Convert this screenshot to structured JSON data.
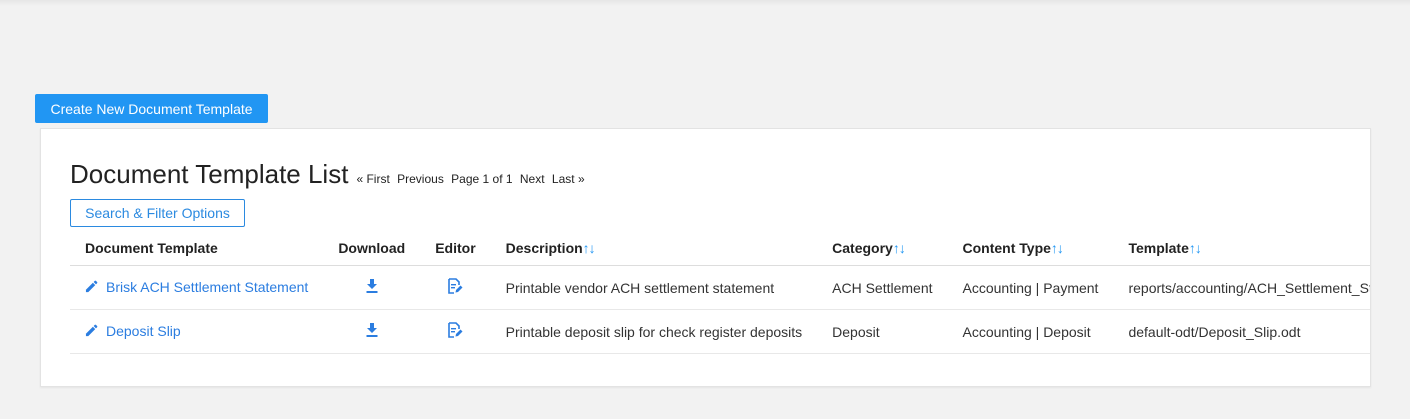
{
  "toolbar": {
    "create_label": "Create New Document Template"
  },
  "list": {
    "title": "Document Template List",
    "pager": {
      "first": "« First",
      "previous": "Previous",
      "page_info": "Page 1 of 1",
      "next": "Next",
      "last": "Last »"
    },
    "filter_label": "Search & Filter Options",
    "sort_glyph": "↑↓",
    "columns": {
      "document_template": "Document Template",
      "download": "Download",
      "editor": "Editor",
      "description": "Description",
      "category": "Category",
      "content_type": "Content Type",
      "template": "Template"
    },
    "rows": [
      {
        "name": "Brisk ACH Settlement Statement",
        "description": "Printable vendor ACH settlement statement",
        "category": "ACH Settlement",
        "content_type": "Accounting | Payment",
        "template": "reports/accounting/ACH_Settlement_Statement.odt"
      },
      {
        "name": "Deposit Slip",
        "description": "Printable deposit slip for check register deposits",
        "category": "Deposit",
        "content_type": "Accounting | Deposit",
        "template": "default-odt/Deposit_Slip.odt"
      }
    ]
  },
  "colors": {
    "accent": "#2196f3",
    "link": "#2b7de0"
  },
  "icons": {
    "edit": "pencil-icon",
    "download": "download-icon",
    "editor": "edit-document-icon"
  }
}
